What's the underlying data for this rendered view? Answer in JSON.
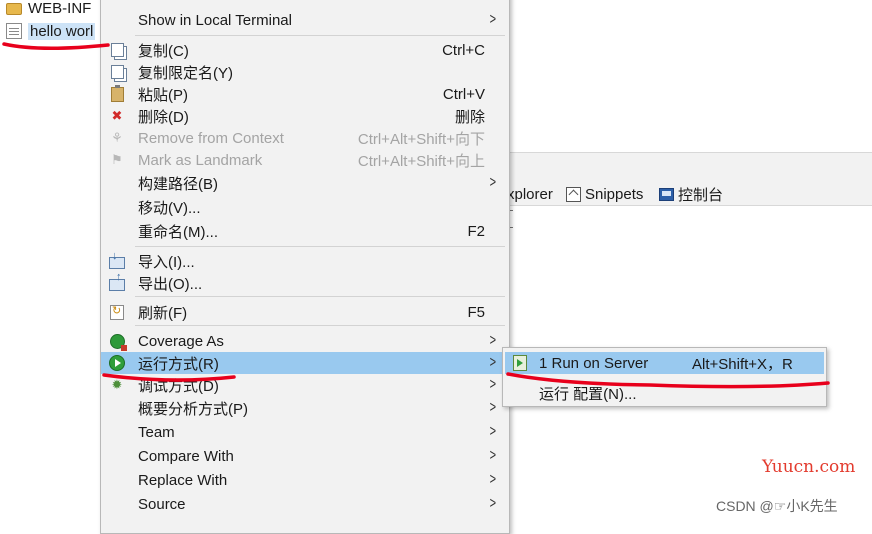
{
  "tree": {
    "items": [
      {
        "label": "WEB-INF",
        "icon": "folder-icon"
      },
      {
        "label": "hello worl",
        "icon": "jsp-file-icon"
      }
    ]
  },
  "views": {
    "tabs": [
      {
        "label": "xplorer"
      },
      {
        "label": "Snippets",
        "icon": "snippets-icon"
      },
      {
        "label": "控制台",
        "icon": "console-icon"
      }
    ]
  },
  "context_menu": {
    "items": [
      {
        "label": "Show in Local Terminal",
        "submenu": true
      },
      {
        "label": "复制(C)",
        "shortcut": "Ctrl+C",
        "icon": "copy-icon"
      },
      {
        "label": "复制限定名(Y)",
        "icon": "copy-qualified-name-icon"
      },
      {
        "label": "粘贴(P)",
        "shortcut": "Ctrl+V",
        "icon": "paste-icon"
      },
      {
        "label": "删除(D)",
        "shortcut": "删除",
        "icon": "delete-icon"
      },
      {
        "label": "Remove from Context",
        "shortcut": "Ctrl+Alt+Shift+向下",
        "icon": "remove-context-icon",
        "disabled": true
      },
      {
        "label": "Mark as Landmark",
        "shortcut": "Ctrl+Alt+Shift+向上",
        "icon": "landmark-icon",
        "disabled": true
      },
      {
        "label": "构建路径(B)",
        "submenu": true
      },
      {
        "label": "移动(V)..."
      },
      {
        "label": "重命名(M)...",
        "shortcut": "F2"
      },
      {
        "label": "导入(I)...",
        "icon": "import-icon"
      },
      {
        "label": "导出(O)...",
        "icon": "export-icon"
      },
      {
        "label": "刷新(F)",
        "shortcut": "F5",
        "icon": "refresh-icon"
      },
      {
        "label": "Coverage As",
        "submenu": true,
        "icon": "coverage-icon"
      },
      {
        "label": "运行方式(R)",
        "submenu": true,
        "icon": "run-icon",
        "highlighted": true
      },
      {
        "label": "调试方式(D)",
        "submenu": true,
        "icon": "debug-icon"
      },
      {
        "label": "概要分析方式(P)",
        "submenu": true
      },
      {
        "label": "Team",
        "submenu": true
      },
      {
        "label": "Compare With",
        "submenu": true
      },
      {
        "label": "Replace With",
        "submenu": true
      },
      {
        "label": "Source",
        "submenu": true
      }
    ]
  },
  "run_submenu": {
    "items": [
      {
        "label": "1 Run on Server",
        "shortcut": "Alt+Shift+X，R",
        "icon": "run-on-server-icon",
        "highlighted": true
      },
      {
        "label": "运行 配置(N)..."
      }
    ]
  },
  "watermarks": {
    "site": "Yuucn.com",
    "author": "CSDN @☞小K先生"
  },
  "colors": {
    "menu_background": "#f2f2f2",
    "highlight": "#99c9ef",
    "annotation": "#e8001c"
  }
}
